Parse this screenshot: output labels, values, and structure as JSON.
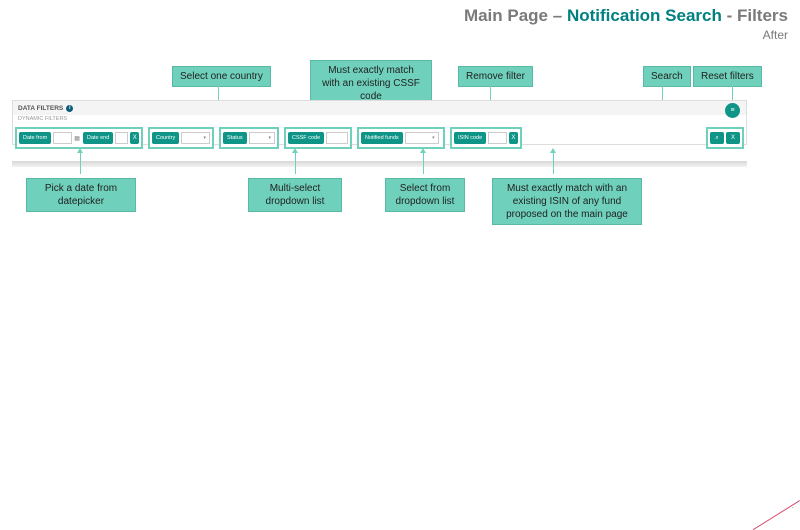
{
  "title": {
    "grey1": "Main Page",
    "sep1": " – ",
    "teal": "Notification Search",
    "sep2": " - ",
    "grey2": "Filters"
  },
  "subtitle": "After",
  "callouts": {
    "country": "Select one country",
    "cssf": "Must exactly match with an existing CSSF code",
    "remove": "Remove filter",
    "search": "Search",
    "reset": "Reset filters",
    "date": "Pick a date from datepicker",
    "status": "Multi-select dropdown list",
    "notified": "Select from dropdown list",
    "isin": "Must exactly match with an existing ISIN of any fund proposed on the main page"
  },
  "panel": {
    "header": "DATA FILTERS",
    "sub": "DYNAMIC FILTERS"
  },
  "filters": {
    "date_from": "Date from",
    "date_end": "Date end",
    "country": "Country",
    "status": "Status",
    "cssf": "CSSF code",
    "notified": "Notified funds",
    "isin": "ISIN code",
    "x": "X",
    "search_icon": "⌕",
    "save_icon": "≡"
  },
  "slide_number": "."
}
